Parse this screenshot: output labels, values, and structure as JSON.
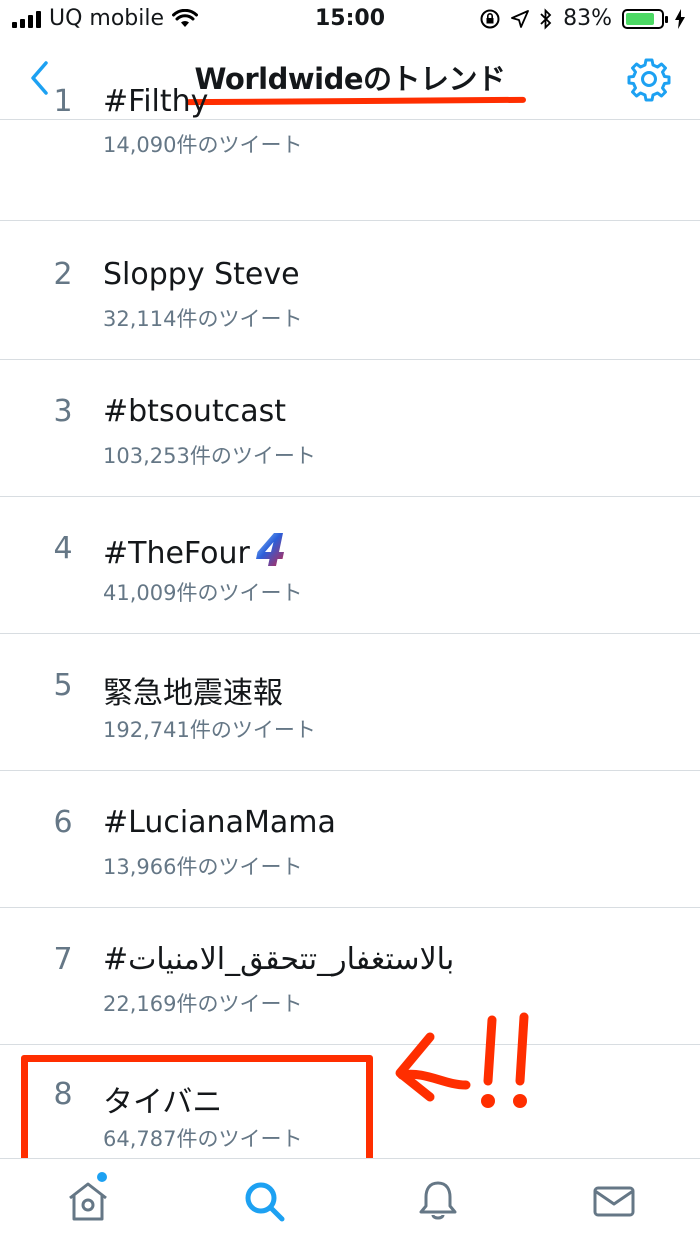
{
  "status_bar": {
    "carrier": "UQ mobile",
    "time": "15:00",
    "battery": "83%",
    "battery_level": 0.83,
    "battery_color": "#4cd964"
  },
  "header": {
    "title": "Worldwideのトレンド",
    "back_icon": "chevron-left-icon",
    "settings_icon": "gear-icon",
    "accent_color": "#1da1f2"
  },
  "trends": [
    {
      "rank": "1",
      "name": "#Filthy",
      "count": "14,090件のツイート"
    },
    {
      "rank": "2",
      "name": "Sloppy Steve",
      "count": "32,114件のツイート"
    },
    {
      "rank": "3",
      "name": "#btsoutcast",
      "count": "103,253件のツイート"
    },
    {
      "rank": "4",
      "name": "#TheFour",
      "count": "41,009件のツイート"
    },
    {
      "rank": "5",
      "name": "緊急地震速報",
      "count": "192,741件のツイート"
    },
    {
      "rank": "6",
      "name": "#LucianaMama",
      "count": "13,966件のツイート"
    },
    {
      "rank": "7",
      "name": "#بالاستغفار_تتحقق_الامنيات",
      "count": "22,169件のツイート"
    },
    {
      "rank": "8",
      "name": "タイバニ",
      "count": "64,787件のツイート"
    }
  ],
  "annotation": {
    "color": "#ff2e00",
    "text": "!!"
  },
  "tab_bar": {
    "items": [
      "home-icon",
      "search-icon",
      "bell-icon",
      "mail-icon"
    ],
    "active": "search-icon"
  }
}
